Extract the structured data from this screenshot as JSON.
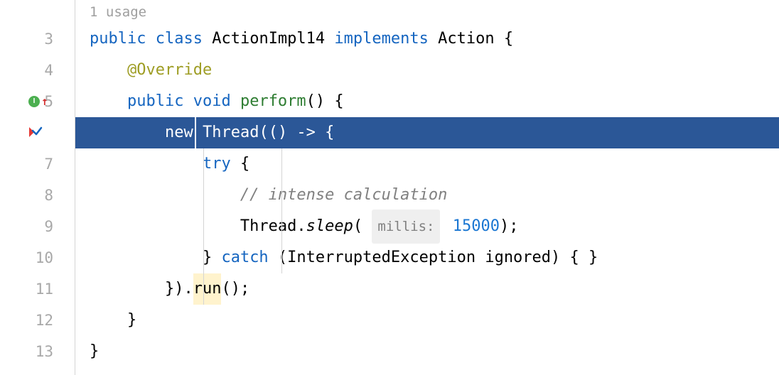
{
  "usage_hint": "1 usage",
  "gutter": {
    "lines": [
      "3",
      "4",
      "5",
      "",
      "7",
      "8",
      "9",
      "10",
      "11",
      "12",
      "13"
    ],
    "icon5": "I",
    "arrow5": "↑"
  },
  "code": {
    "l3": {
      "kw_public": "public",
      "kw_class": "class",
      "classname": "ActionImpl14",
      "kw_implements": "implements",
      "iface": "Action",
      "brace": " {"
    },
    "l4": {
      "annotation": "@Override"
    },
    "l5": {
      "kw_public": "public",
      "kw_void": "void",
      "method": "perform",
      "rest": "() {"
    },
    "l6": {
      "kw_new": "new",
      "ctor": "Thread",
      "rest": "(() -> {"
    },
    "l7": {
      "kw_try": "try",
      "brace": " {"
    },
    "l8": {
      "comment": "// intense calculation"
    },
    "l9": {
      "cls": "Thread",
      "dot": ".",
      "method": "sleep",
      "lparen": "( ",
      "hint": "millis:",
      "value": "15000",
      "rest": ");"
    },
    "l10": {
      "rbrace": "} ",
      "kw_catch": "catch",
      "rest": " (InterruptedException ignored) { }"
    },
    "l11": {
      "pre": "}).",
      "call": "run",
      "rest": "();"
    },
    "l12": {
      "brace": "}"
    },
    "l13": {
      "brace": "}"
    }
  }
}
